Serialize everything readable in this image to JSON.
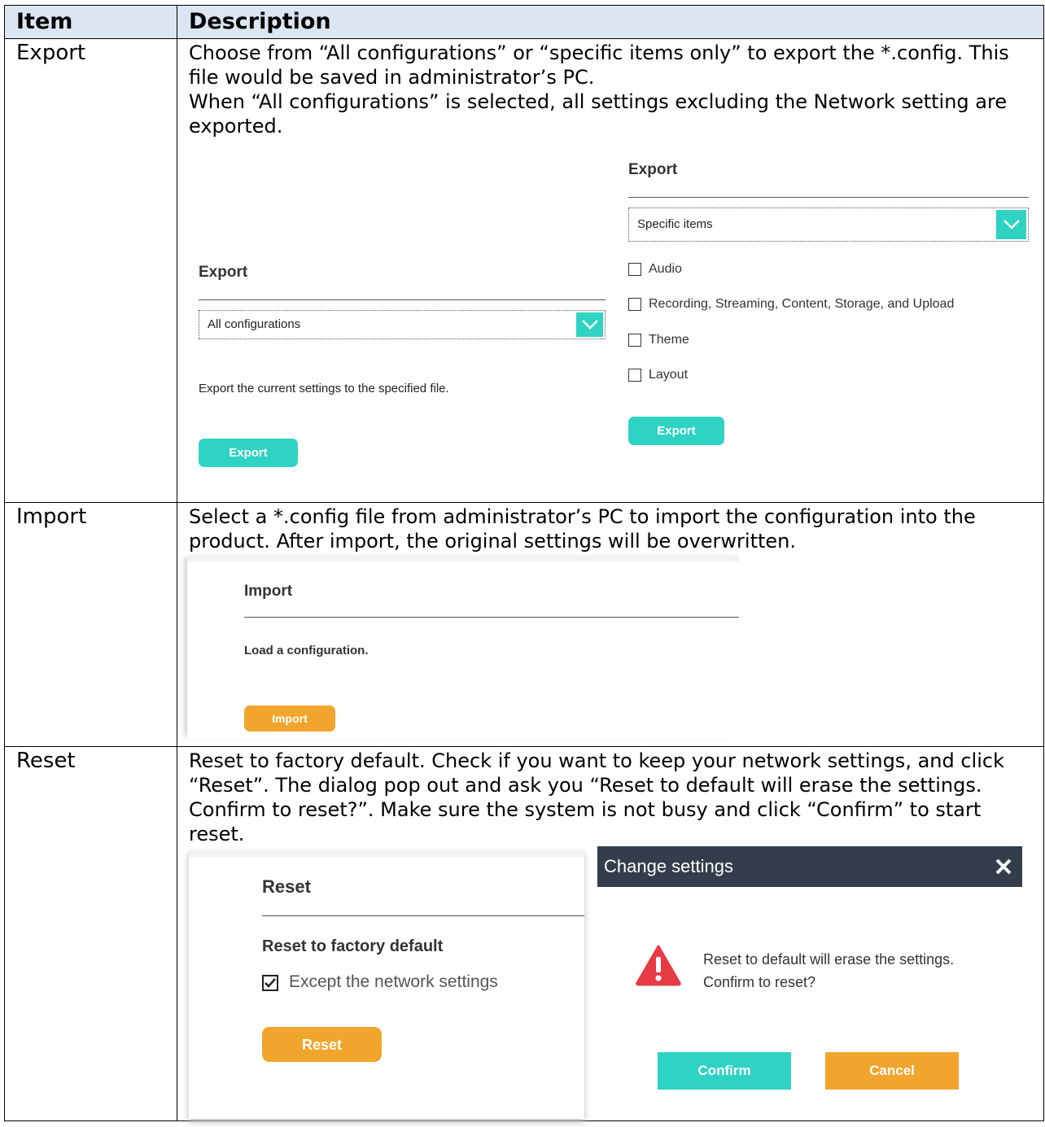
{
  "table": {
    "headers": [
      "Item",
      "Description"
    ],
    "rows": [
      {
        "item": "Export",
        "description": "Choose from “All configurations” or “specific items only” to export the *.config. This file would be saved in administrator’s PC.\nWhen “All configurations” is selected, all settings excluding the Network setting are exported.",
        "left_panel": {
          "title": "Export",
          "select_value": "All configurations",
          "note": "Export the current settings to the specified file.",
          "button": "Export"
        },
        "right_panel": {
          "title": "Export",
          "select_value": "Specific items",
          "options": [
            "Audio",
            "Recording, Streaming, Content, Storage, and Upload",
            "Theme",
            "Layout"
          ],
          "button": "Export"
        }
      },
      {
        "item": "Import",
        "description": "Select a *.config file from administrator’s PC to import the configuration into the product. After import, the original settings will be overwritten.",
        "panel": {
          "title": "Import",
          "note": "Load a configuration.",
          "button": "Import"
        }
      },
      {
        "item": "Reset",
        "description": "Reset to factory default. Check if you want to keep your network settings, and click “Reset”. The dialog pop out and ask you “Reset to default will erase the settings. Confirm to reset?”. Make sure the system is not busy and click “Confirm” to start reset.",
        "panel": {
          "title": "Reset",
          "subtitle": "Reset to factory default",
          "checkbox_label": "Except the network settings",
          "button": "Reset"
        },
        "dialog": {
          "title": "Change settings",
          "message": "Reset to default will erase the settings. Confirm to reset?",
          "confirm": "Confirm",
          "cancel": "Cancel"
        }
      }
    ]
  },
  "colors": {
    "header_bg": "#dce6f2",
    "teal": "#2fd3c3",
    "orange": "#f2a52c",
    "dialog_bar": "#333d4b",
    "warning_red": "#e63b44"
  },
  "icons": [
    "chevron-down-icon",
    "checkbox-icon",
    "warning-triangle-icon",
    "close-icon"
  ]
}
